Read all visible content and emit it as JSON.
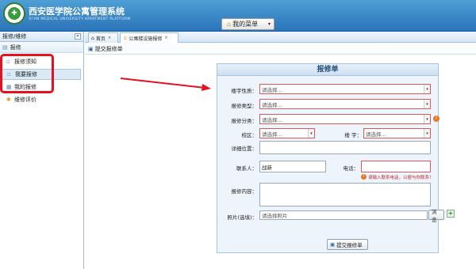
{
  "header": {
    "title": "西安医学院公寓管理系统",
    "subtitle": "XI'AN MEDICAL UNIVERSITY APARTMENT PLATFORM",
    "menu_button": "我的菜单"
  },
  "sidebar": {
    "panel_title": "报修/维修",
    "collapse_symbol": "«",
    "section_title": "报修",
    "items": [
      {
        "label": "报修须知"
      },
      {
        "label": "我要报修"
      },
      {
        "label": "我的报修"
      },
      {
        "label": "维修评价"
      }
    ]
  },
  "tabs": [
    {
      "label": "首页"
    },
    {
      "label": "公寓楼设施报修"
    }
  ],
  "toolbar": {
    "submit_label": "提交报修单"
  },
  "form": {
    "title": "报修单",
    "building_nature_label": "楼宇性质：",
    "building_nature_placeholder": "请选择...",
    "repair_type_label": "报修类型：",
    "repair_type_placeholder": "请选择...",
    "repair_category_label": "报修分类：",
    "repair_category_placeholder": "请选择...",
    "campus_label": "校区：",
    "campus_placeholder": "请选择...",
    "building_label": "楼 宇：",
    "building_placeholder": "请选择...",
    "location_label": "详细位置：",
    "contact_label": "联系人：",
    "contact_value": "战新",
    "phone_label": "电话：",
    "phone_hint": "请输入联系电话，以便与你联系！",
    "content_label": "报修内容：",
    "photo_label": "照片(选填)：",
    "photo_placeholder": "请选择照片",
    "browse_label": "浏览",
    "submit_label": "提交报修单"
  },
  "colors": {
    "header_blue": "#2a73b8",
    "highlight_red": "#e4121f",
    "form_bg": "#eef4fb"
  }
}
